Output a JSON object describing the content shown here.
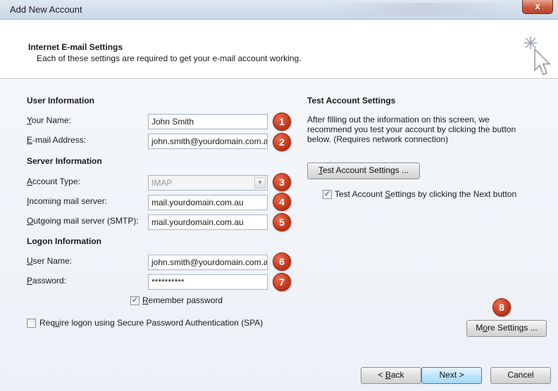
{
  "window": {
    "title": "Add New Account",
    "close_label": "x"
  },
  "header": {
    "title": "Internet E-mail Settings",
    "subtitle": "Each of these settings are required to get your e-mail account working."
  },
  "user_info": {
    "heading": "User Information",
    "name_label_u": "Y",
    "name_label_rest": "our Name:",
    "name_value": "John Smith",
    "email_label_u": "E",
    "email_label_rest": "-mail Address:",
    "email_value": "john.smith@yourdomain.com.au"
  },
  "server_info": {
    "heading": "Server Information",
    "account_type_label_u": "A",
    "account_type_label_rest": "ccount Type:",
    "account_type_value": "IMAP",
    "incoming_label_u": "I",
    "incoming_label_rest": "ncoming mail server:",
    "incoming_value": "mail.yourdomain.com.au",
    "outgoing_label_u": "O",
    "outgoing_label_rest": "utgoing mail server (SMTP):",
    "outgoing_value": "mail.yourdomain.com.au"
  },
  "logon_info": {
    "heading": "Logon Information",
    "username_label_u": "U",
    "username_label_rest": "ser Name:",
    "username_value": "john.smith@yourdomain.com.au",
    "password_label_u": "P",
    "password_label_rest": "assword:",
    "password_value": "**********",
    "remember_label_u": "R",
    "remember_label_rest": "emember password",
    "remember_checked": true,
    "spa_label_pre": "Req",
    "spa_label_u": "u",
    "spa_label_rest": "ire logon using Secure Password Authentication (SPA)",
    "spa_checked": false
  },
  "test": {
    "heading": "Test Account Settings",
    "description_line1": "After filling out the information on this screen, we",
    "description_line2": "recommend you test your account by clicking the button",
    "description_line3": "below. (Requires network connection)",
    "button_u": "T",
    "button_rest": "est Account Settings ...",
    "next_check_pre": "Test Account ",
    "next_check_u": "S",
    "next_check_rest": "ettings by clicking the Next button",
    "next_checked": true
  },
  "more_settings": {
    "label_pre": "M",
    "label_u": "o",
    "label_rest": "re Settings ..."
  },
  "footer": {
    "back_pre": "< ",
    "back_u": "B",
    "back_rest": "ack",
    "next_label": "Next >",
    "cancel_label": "Cancel"
  },
  "badges": [
    "1",
    "2",
    "3",
    "4",
    "5",
    "6",
    "7",
    "8"
  ],
  "colors": {
    "badge": "#c23a1f",
    "close_button": "#c75a3f",
    "body_bg": "#eef2f7",
    "primary_button": "#bee6fd"
  },
  "icons": {
    "header": "cursor-sparkle-icon",
    "combo": "chevron-down-icon",
    "check": "checkmark-icon"
  }
}
